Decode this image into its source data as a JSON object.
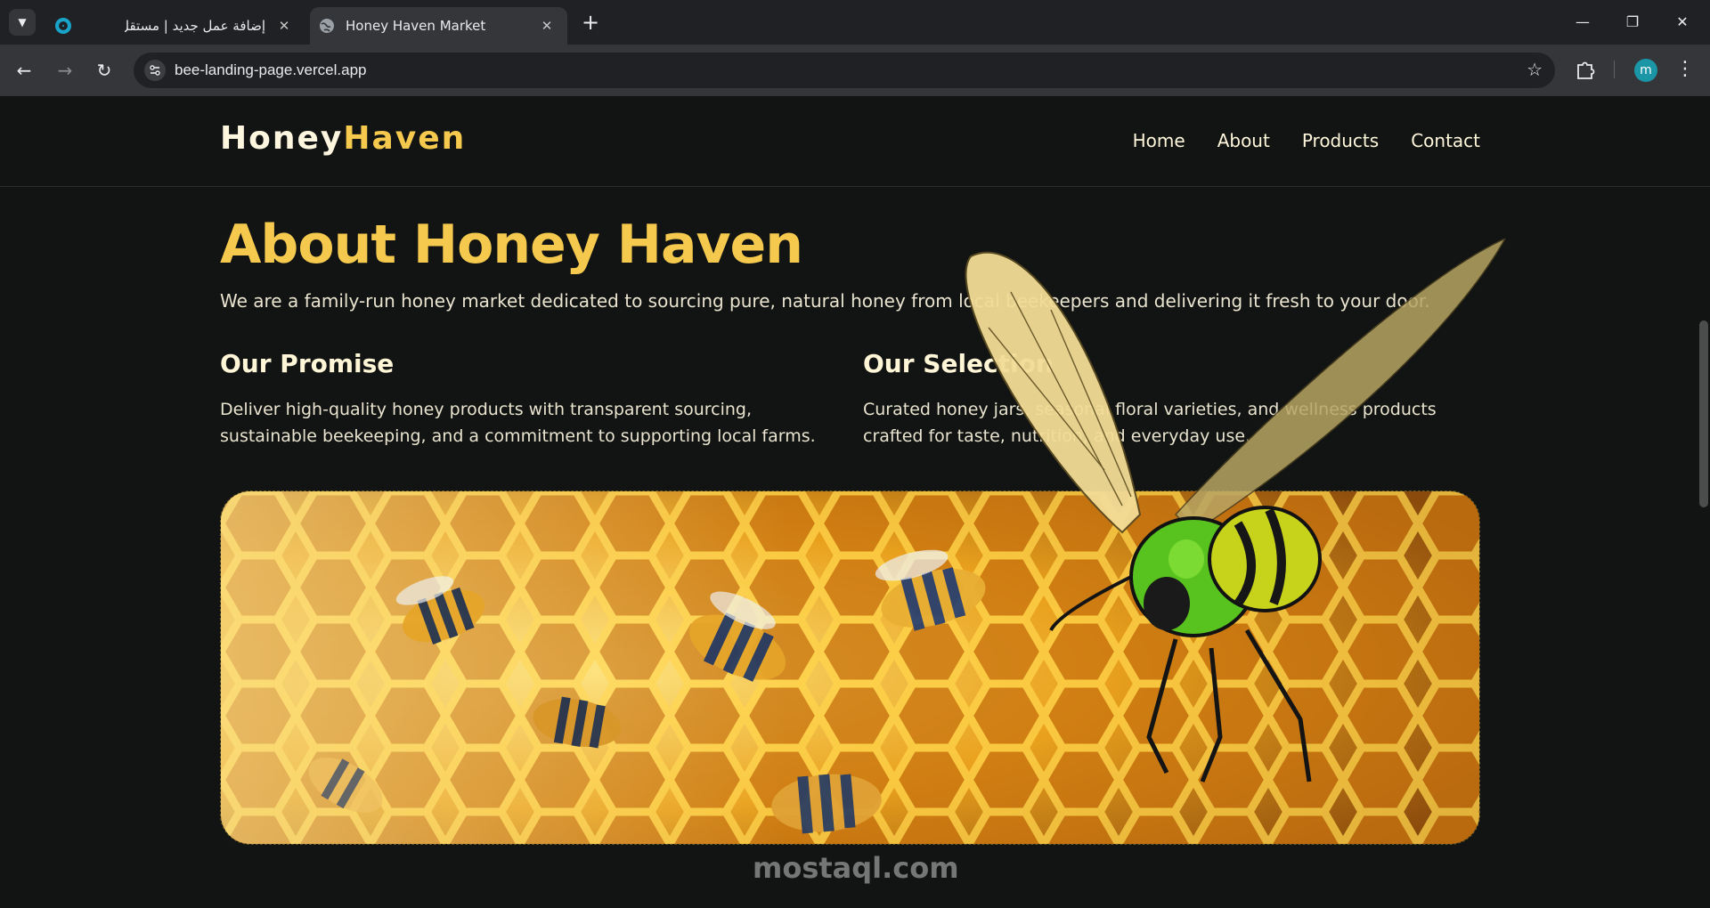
{
  "browser": {
    "tabs": [
      {
        "title": "إضافة عمل جديد | مستقل",
        "active": false
      },
      {
        "title": "Honey Haven Market",
        "active": true
      }
    ],
    "url": "bee-landing-page.vercel.app",
    "profile_initial": "m",
    "icons": {
      "tab_list": "chevron-down-icon",
      "close": "close-icon",
      "new_tab": "plus-icon",
      "back": "arrow-left-icon",
      "forward": "arrow-right-icon",
      "reload": "reload-icon",
      "site_info": "tune-icon",
      "bookmark": "star-icon",
      "extensions": "puzzle-icon",
      "menu": "kebab-icon"
    }
  },
  "site": {
    "logo": {
      "part1": "Honey",
      "part2": "Haven"
    },
    "nav": [
      "Home",
      "About",
      "Products",
      "Contact"
    ],
    "about": {
      "title": "About Honey Haven",
      "description": "We are a family-run honey market dedicated to sourcing pure, natural honey from local beekeepers and delivering it fresh to your door."
    },
    "promise": {
      "heading": "Our Promise",
      "text": "Deliver high-quality honey products with transparent sourcing, sustainable beekeeping, and a commitment to supporting local farms."
    },
    "selection": {
      "heading": "Our Selection",
      "text": "Curated honey jars, seasonal floral varieties, and wellness products crafted for taste, nutrition, and everyday use."
    },
    "colors": {
      "accent": "#f5c94e",
      "background": "#111412",
      "text": "#e9e3cf"
    }
  },
  "watermark": "mostaql.com"
}
